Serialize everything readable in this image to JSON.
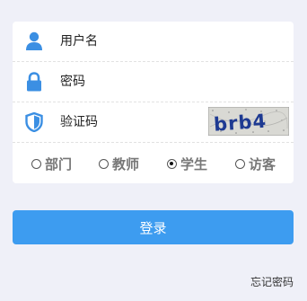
{
  "form": {
    "username": {
      "placeholder": "用户名",
      "icon": "user-icon"
    },
    "password": {
      "placeholder": "密码",
      "icon": "lock-icon"
    },
    "captcha": {
      "placeholder": "验证码",
      "icon": "shield-icon",
      "image_text": "brb4"
    },
    "roles": [
      {
        "label": "部门",
        "checked": false
      },
      {
        "label": "教师",
        "checked": false
      },
      {
        "label": "学生",
        "checked": true
      },
      {
        "label": "访客",
        "checked": false
      }
    ]
  },
  "actions": {
    "login_label": "登录",
    "forgot_label": "忘记密码"
  },
  "colors": {
    "background": "#eff0f8",
    "accent": "#3d9cf0",
    "icon": "#3b8fe3",
    "card": "#ffffff"
  }
}
